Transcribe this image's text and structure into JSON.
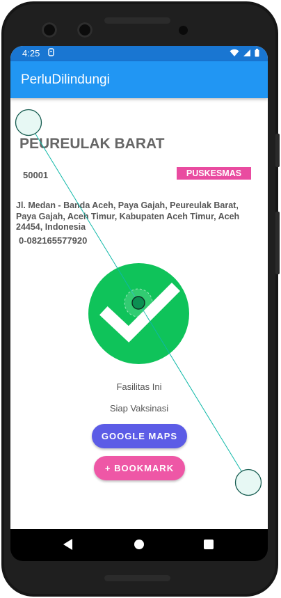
{
  "status_bar": {
    "time": "4:25",
    "icons": [
      "wifi-icon",
      "signal-icon",
      "battery-icon"
    ]
  },
  "app_bar": {
    "title": "PerluDilindungi"
  },
  "facility": {
    "name": "PEUREULAK BARAT",
    "code": "50001",
    "type": "PUSKESMAS",
    "address": "Jl. Medan - Banda Aceh, Paya Gajah, Peureulak Barat, Paya Gajah, Aceh Timur, Kabupaten Aceh Timur, Aceh 24454, Indonesia",
    "phone": "0-082165577920"
  },
  "status": {
    "line1": "Fasilitas Ini",
    "line2": "Siap Vaksinasi",
    "icon": "checkmark-icon"
  },
  "actions": {
    "maps_label": "GOOGLE MAPS",
    "bookmark_label": "+ BOOKMARK"
  },
  "navigation": [
    "back-icon",
    "home-icon",
    "recents-icon"
  ],
  "colors": {
    "status_bar": "#1976d2",
    "app_bar": "#2196f3",
    "badge": "#e94ba0",
    "check": "#0fc35a",
    "maps_button": "#5c5ce6",
    "bookmark_button": "#ee57a6",
    "gesture_overlay": "#0fb8a8"
  }
}
